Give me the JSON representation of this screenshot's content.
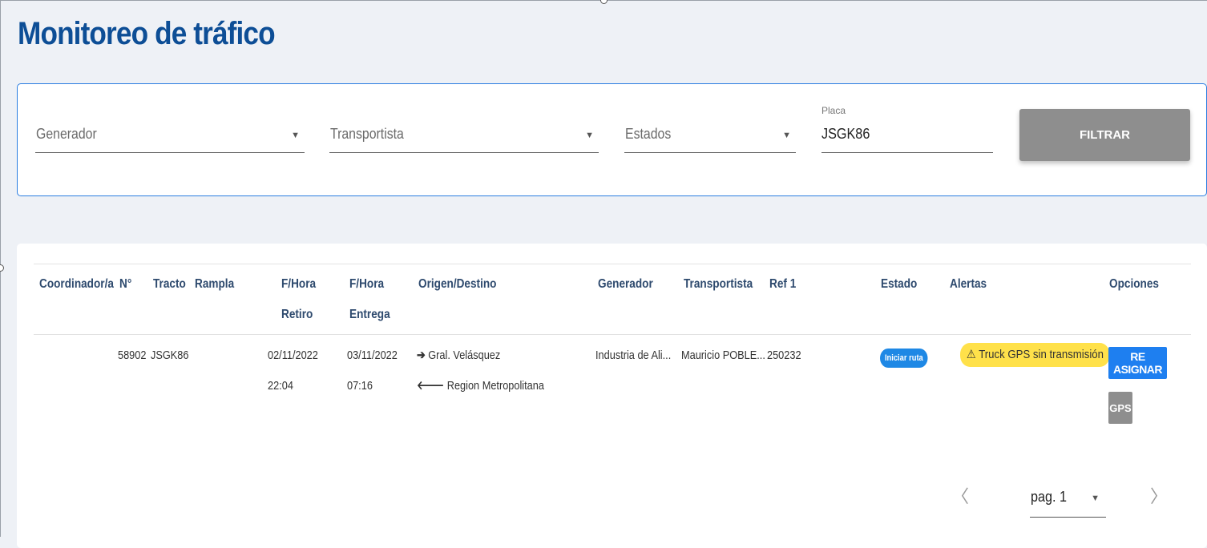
{
  "page": {
    "title": "Monitoreo de tráfico"
  },
  "filters": {
    "generador": {
      "placeholder": "Generador"
    },
    "transportista": {
      "placeholder": "Transportista"
    },
    "estados": {
      "placeholder": "Estados"
    },
    "placa": {
      "label": "Placa",
      "value": "JSGK86"
    },
    "filter_button": "FILTRAR"
  },
  "table": {
    "headers": {
      "coordinador": "Coordinador/a",
      "numero": "N°",
      "tracto": "Tracto",
      "rampla": "Rampla",
      "retiro_1": "F/Hora",
      "retiro_2": "Retiro",
      "entrega_1": "F/Hora",
      "entrega_2": "Entrega",
      "origen_destino": "Origen/Destino",
      "generador": "Generador",
      "transportista": "Transportista",
      "ref1": "Ref 1",
      "estado": "Estado",
      "alertas": "Alertas",
      "opciones": "Opciones"
    },
    "rows": [
      {
        "coordinador": "",
        "numero": "58902",
        "tracto": "JSGK86",
        "rampla": "",
        "retiro_fecha": "02/11/2022",
        "retiro_hora": "22:04",
        "entrega_fecha": "03/11/2022",
        "entrega_hora": "07:16",
        "origen": "Gral. Velásquez",
        "destino": "Region Metropolitana",
        "generador": "Industria de Ali...",
        "transportista": "Mauricio POBLE...",
        "ref1": "250232",
        "estado": "Iniciar ruta",
        "alerta": "Truck GPS sin transmisión",
        "opciones": {
          "reasignar": "RE ASIGNAR",
          "gps": "GPS"
        }
      }
    ]
  },
  "pagination": {
    "page_label": "pag. 1"
  },
  "icons": {
    "caret": "caret-down-icon",
    "origin": "arrow-right-icon",
    "destination": "arrow-left-icon",
    "alert": "warning-icon",
    "prev": "chevron-left-icon",
    "next": "chevron-right-icon"
  },
  "colors": {
    "title": "#0d4e96",
    "accent_blue": "#1e88e5",
    "alert_yellow": "#ffe14a",
    "button_grey": "#8e8e8e"
  }
}
